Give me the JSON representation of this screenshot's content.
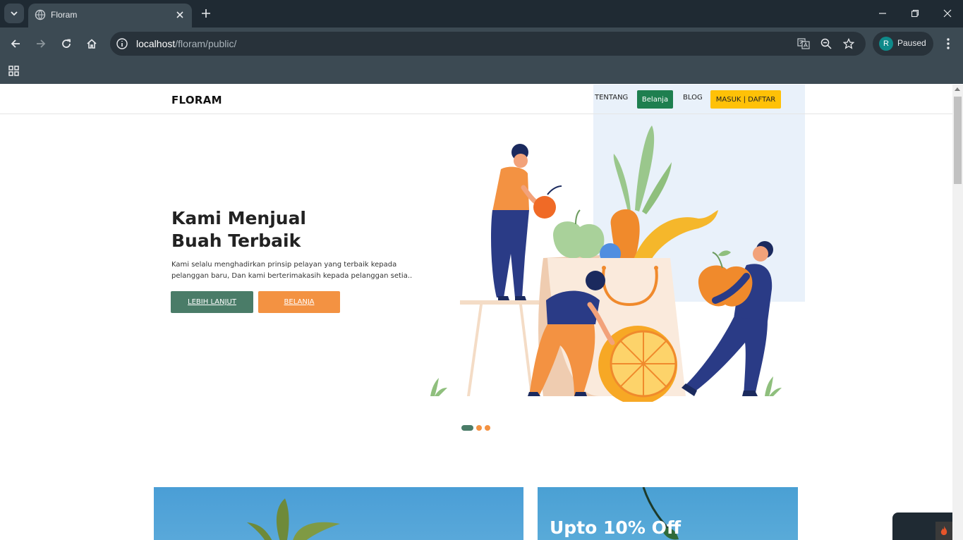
{
  "browser": {
    "tab_title": "Floram",
    "url_host": "localhost",
    "url_path": "/floram/public/",
    "profile_initial": "R",
    "profile_status": "Paused"
  },
  "site": {
    "brand": "FLORAM",
    "nav": {
      "tentang": "TENTANG",
      "belanja": "Belanja",
      "blog": "BLOG",
      "masuk": "MASUK | DAFTAR"
    },
    "hero": {
      "title_line1": "Kami Menjual",
      "title_line2": "Buah Terbaik",
      "description": "Kami selalu menghadirkan prinsip pelayan yang terbaik kepada pelanggan baru, Dan kami berterimakasih kepada pelanggan setia..",
      "btn_more": "LEBIH LANJUT",
      "btn_shop": "BELANJA"
    },
    "carousel": {
      "active_index": 0,
      "count": 3
    },
    "promo_card_title": "Upto 10% Off"
  },
  "colors": {
    "green_primary": "#4a7c68",
    "orange": "#f39242",
    "nav_green": "#1e7f4f",
    "yellow": "#ffc107",
    "hero_bg": "#e9f1fa"
  }
}
